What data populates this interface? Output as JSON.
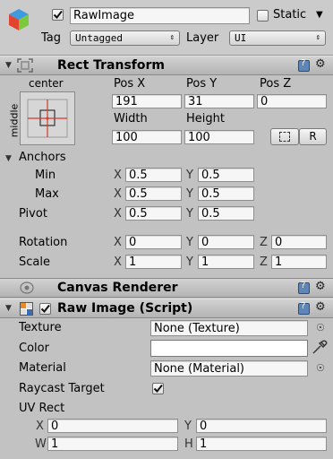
{
  "gameobject": {
    "name": "RawImage",
    "active": true,
    "static_label": "Static",
    "tag_label": "Tag",
    "tag_value": "Untagged",
    "layer_label": "Layer",
    "layer_value": "UI"
  },
  "rect_transform": {
    "title": "Rect Transform",
    "anchor_preset_h": "center",
    "anchor_preset_v": "middle",
    "pos_x_label": "Pos X",
    "pos_y_label": "Pos Y",
    "pos_z_label": "Pos Z",
    "pos_x": "191",
    "pos_y": "31",
    "pos_z": "0",
    "width_label": "Width",
    "height_label": "Height",
    "width": "100",
    "height": "100",
    "raw_button": "R",
    "anchors_label": "Anchors",
    "min_label": "Min",
    "max_label": "Max",
    "pivot_label": "Pivot",
    "min_x": "0.5",
    "min_y": "0.5",
    "max_x": "0.5",
    "max_y": "0.5",
    "pivot_x": "0.5",
    "pivot_y": "0.5",
    "rotation_label": "Rotation",
    "rot_x": "0",
    "rot_y": "0",
    "rot_z": "0",
    "scale_label": "Scale",
    "scale_x": "1",
    "scale_y": "1",
    "scale_z": "1",
    "axis_x": "X",
    "axis_y": "Y",
    "axis_z": "Z"
  },
  "canvas_renderer": {
    "title": "Canvas Renderer"
  },
  "raw_image": {
    "title": "Raw Image (Script)",
    "enabled": true,
    "texture_label": "Texture",
    "texture_value": "None (Texture)",
    "color_label": "Color",
    "color_value": "#ffffff",
    "material_label": "Material",
    "material_value": "None (Material)",
    "raycast_label": "Raycast Target",
    "raycast_value": true,
    "uv_rect_label": "UV Rect",
    "uv_x_label": "X",
    "uv_y_label": "Y",
    "uv_w_label": "W",
    "uv_h_label": "H",
    "uv_x": "0",
    "uv_y": "0",
    "uv_w": "1",
    "uv_h": "1"
  },
  "icons": {
    "gameobject": "cube-icon",
    "rect_transform": "rect-transform-icon",
    "canvas_renderer": "canvas-renderer-icon",
    "raw_image": "raw-image-icon",
    "help": "help-book-icon",
    "settings": "gear-icon",
    "picker": "object-picker-icon",
    "eyedropper": "eyedropper-icon"
  },
  "colors": {
    "accent_blue": "#5f86b8",
    "panel": "#c2c2c2"
  }
}
